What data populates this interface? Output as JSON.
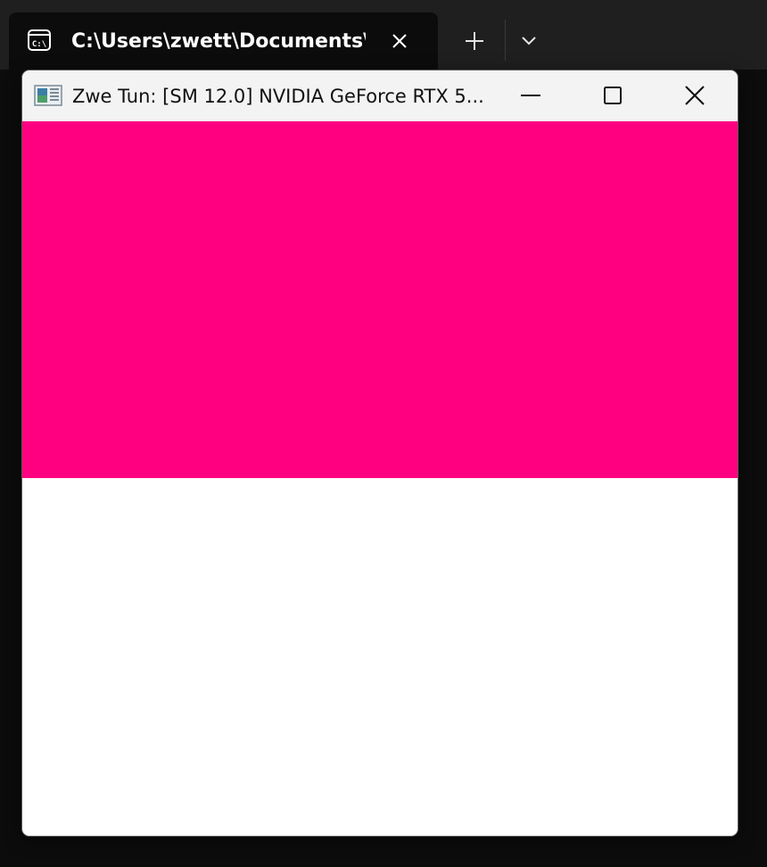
{
  "terminal": {
    "tab_title": "C:\\Users\\zwett\\Documents\\GI",
    "tab_icon": "terminal-icon",
    "close_icon": "close-icon",
    "new_tab_icon": "plus-icon",
    "dropdown_icon": "chevron-down-icon"
  },
  "window": {
    "title": "Zwe Tun: [SM 12.0] NVIDIA GeForce RTX 5...",
    "app_icon": "app-window-icon",
    "controls": {
      "minimize_icon": "minimize-icon",
      "maximize_icon": "maximize-icon",
      "close_icon": "close-icon"
    }
  },
  "render": {
    "top_color": "#ff0080",
    "bottom_color": "#ffffff"
  }
}
